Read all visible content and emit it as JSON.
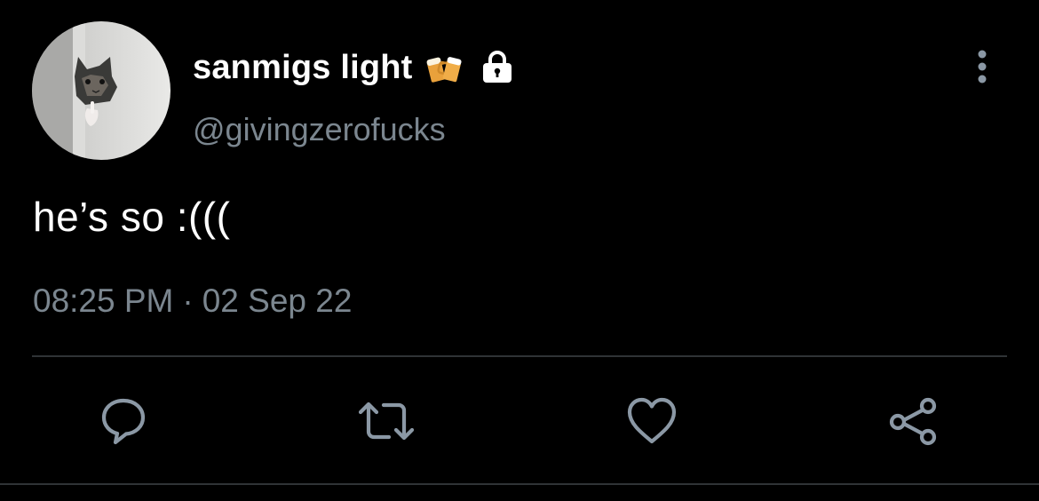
{
  "tweet": {
    "author": {
      "display_name": "sanmigs light",
      "name_emoji": "beer-mugs-emoji",
      "protected_icon": "lock-icon",
      "handle": "@givingzerofucks"
    },
    "text": "he’s so :(((",
    "time": "08:25 PM",
    "separator": "·",
    "date": "02 Sep 22"
  },
  "menu": {
    "icon": "more-vertical-icon"
  },
  "actions": {
    "reply_icon": "reply-icon",
    "retweet_icon": "retweet-icon",
    "like_icon": "heart-icon",
    "share_icon": "share-icon"
  },
  "colors": {
    "background": "#000000",
    "primary_text": "#ffffff",
    "secondary_text": "#7b868f",
    "icon": "#8b98a5",
    "divider": "#2f3336"
  }
}
